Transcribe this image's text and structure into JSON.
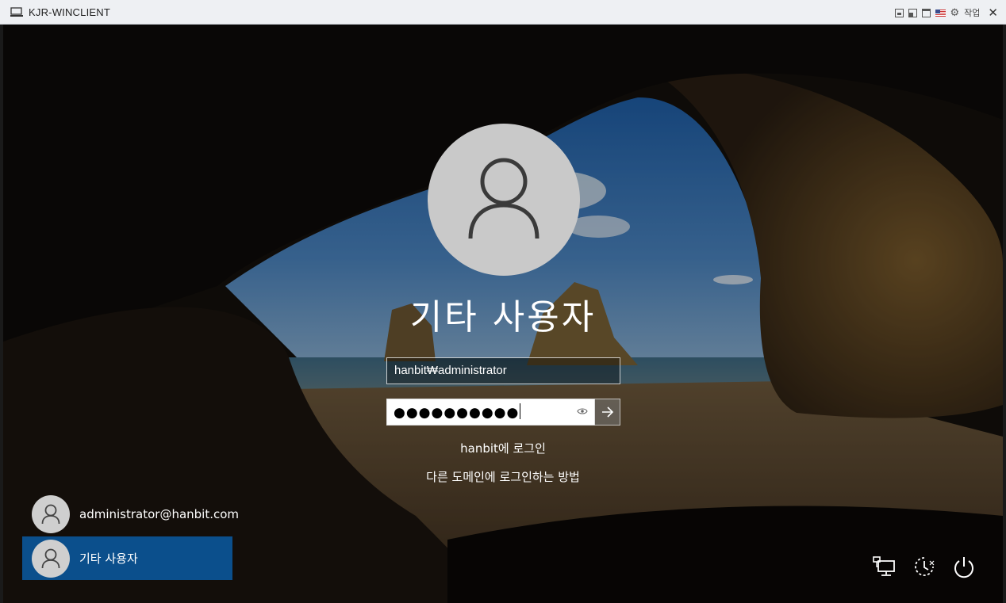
{
  "window": {
    "title": "KJR-WINCLIENT",
    "work_label": "작업"
  },
  "login": {
    "current_user": "기타 사용자",
    "username_value": "hanbit₩administrator",
    "password_mask": "●●●●●●●●●●",
    "sign_in_to": "hanbit에 로그인",
    "other_domain_link": "다른 도메인에 로그인하는 방법"
  },
  "user_list": [
    {
      "label": "administrator@hanbit.com",
      "selected": false
    },
    {
      "label": "기타 사용자",
      "selected": true
    }
  ],
  "icons": {
    "titlebar": [
      "computer-icon",
      "restore-icon",
      "window-icon",
      "maximize-icon",
      "flag-icon",
      "gear-icon",
      "close-icon"
    ],
    "system": [
      "network-icon",
      "ease-of-access-icon",
      "power-icon"
    ]
  },
  "colors": {
    "selected_tile": "#0b4f8c",
    "avatar": "#c9c9c9"
  }
}
